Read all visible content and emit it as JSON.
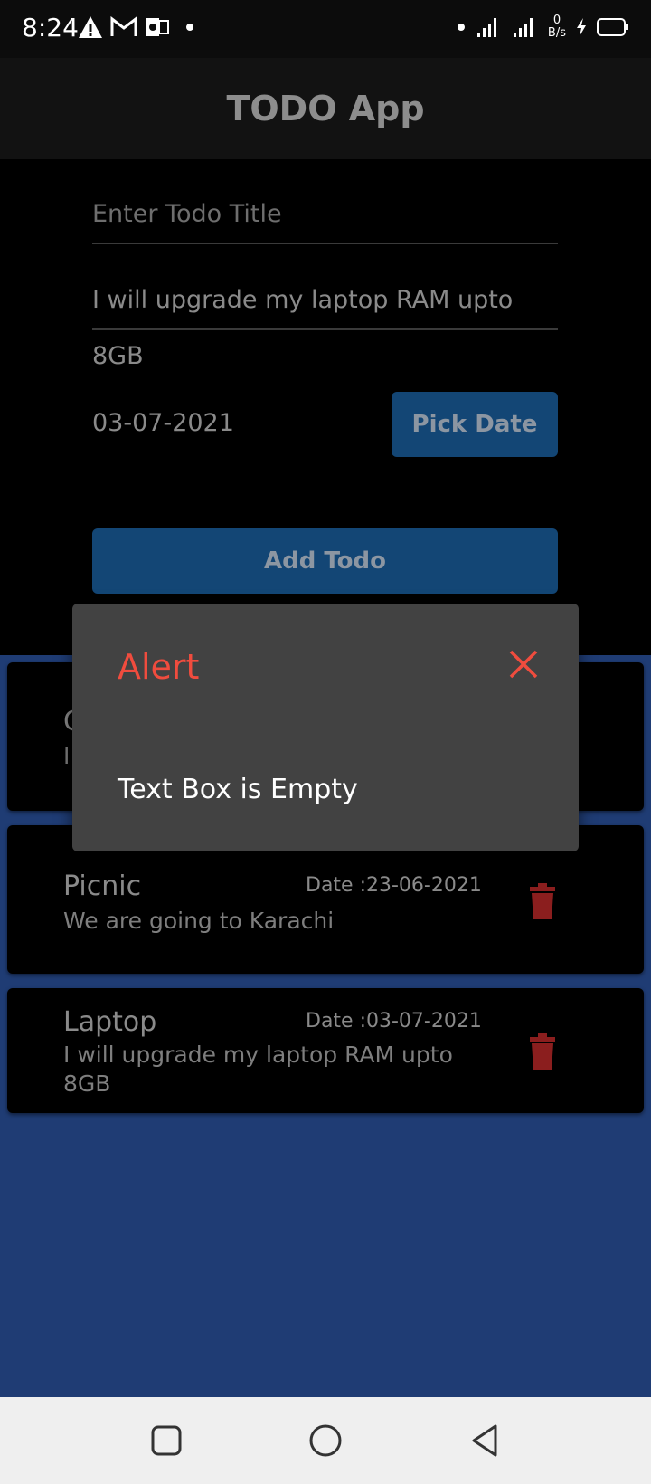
{
  "status_bar": {
    "time": "8:24",
    "left_icons": [
      "warning-icon",
      "gmail-icon",
      "outlook-icon",
      "dot-icon"
    ],
    "right_icons": [
      "dot-icon",
      "signal-icon",
      "signal-icon",
      "netspeed",
      "charging-icon",
      "battery-icon"
    ],
    "netspeed_value": "0",
    "netspeed_unit": "B/s"
  },
  "app_bar": {
    "title": "TODO App"
  },
  "form": {
    "title_placeholder": "Enter Todo Title",
    "description_value": "I will upgrade my laptop RAM upto 8GB",
    "date_value": "03-07-2021",
    "pick_date_label": "Pick Date",
    "add_todo_label": "Add Todo"
  },
  "todos": [
    {
      "title": "C",
      "description": "I",
      "date": ""
    },
    {
      "title": "Picnic",
      "description": "We are going to Karachi",
      "date": "Date :23-06-2021"
    },
    {
      "title": "Laptop",
      "description": "I will upgrade my laptop RAM upto 8GB",
      "date": "Date :03-07-2021"
    }
  ],
  "dialog": {
    "title": "Alert",
    "message": "Text Box is Empty",
    "close_icon": "close-icon"
  },
  "nav_bar": {
    "icons": [
      "recents-icon",
      "home-icon",
      "back-icon"
    ]
  },
  "colors": {
    "background": "#1f3c74",
    "button": "#134675",
    "alert_title": "#f04c3e",
    "trash": "#8b1e1e",
    "dialog": "#424242"
  }
}
